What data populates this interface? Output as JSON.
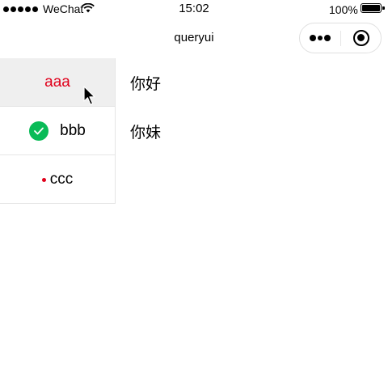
{
  "status_bar": {
    "carrier": "WeChat",
    "time": "15:02",
    "battery": "100%"
  },
  "nav_bar": {
    "title": "queryui"
  },
  "side_menu": {
    "items": [
      {
        "label": "aaa",
        "active": true
      },
      {
        "label": "bbb",
        "icon": "check-circle-icon"
      },
      {
        "label": "ccc",
        "icon": "red-dot-icon"
      }
    ]
  },
  "content": {
    "rows": [
      "你好",
      "你妹"
    ]
  },
  "colors": {
    "active_text": "#e0001b",
    "check_green": "#09bb57",
    "active_bg": "#efefef"
  }
}
